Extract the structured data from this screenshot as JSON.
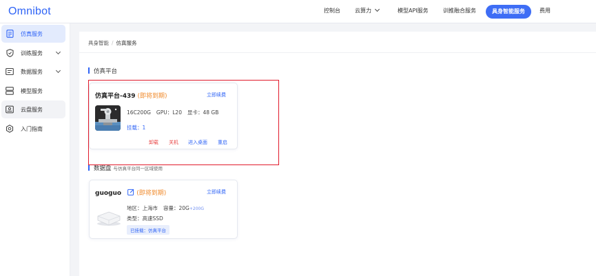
{
  "app": {
    "logo": "Omnibot"
  },
  "nav": {
    "items": [
      "控制台",
      "云算力",
      "模型API服务",
      "训推融合服务"
    ],
    "active": "具身智能服务",
    "last": "费用"
  },
  "sidebar": {
    "items": [
      {
        "label": "仿真服务",
        "icon": "document-icon"
      },
      {
        "label": "训练服务",
        "icon": "shield-icon"
      },
      {
        "label": "数据服务",
        "icon": "data-icon"
      },
      {
        "label": "模型服务",
        "icon": "server-icon"
      },
      {
        "label": "云盘服务",
        "icon": "cloud-disk-icon"
      },
      {
        "label": "入门指南",
        "icon": "gear-icon"
      }
    ]
  },
  "breadcrumb": {
    "parent": "具身智能",
    "current": "仿真服务"
  },
  "sim_section": {
    "title": "仿真平台"
  },
  "sim_card": {
    "name": "仿真平台-439",
    "status": "(即将到期)",
    "renew": "立即续费",
    "cpu": "16C200G",
    "gpu": "GPU：L20",
    "vram": "显卡：48 GB",
    "mount": "挂载：1",
    "actions": {
      "uninstall": "卸载",
      "shutdown": "关机",
      "desktop": "进入桌面",
      "restart": "重启"
    }
  },
  "disk_section": {
    "title": "数据盘",
    "note": "与仿真平台同一区域使用"
  },
  "disk_card": {
    "name": "guoguo",
    "status": "(即将到期)",
    "renew": "立即续费",
    "region": "地区：上海市",
    "capacity": "容量：20G",
    "capacity_extra": "+200G",
    "type": "类型：高速SSD",
    "mounted_tag": "已挂载：仿真平台"
  },
  "colors": {
    "accent": "#2f64f6",
    "warning": "#f08a2b",
    "danger": "#e84545",
    "highlight_box": "#e0192a"
  }
}
